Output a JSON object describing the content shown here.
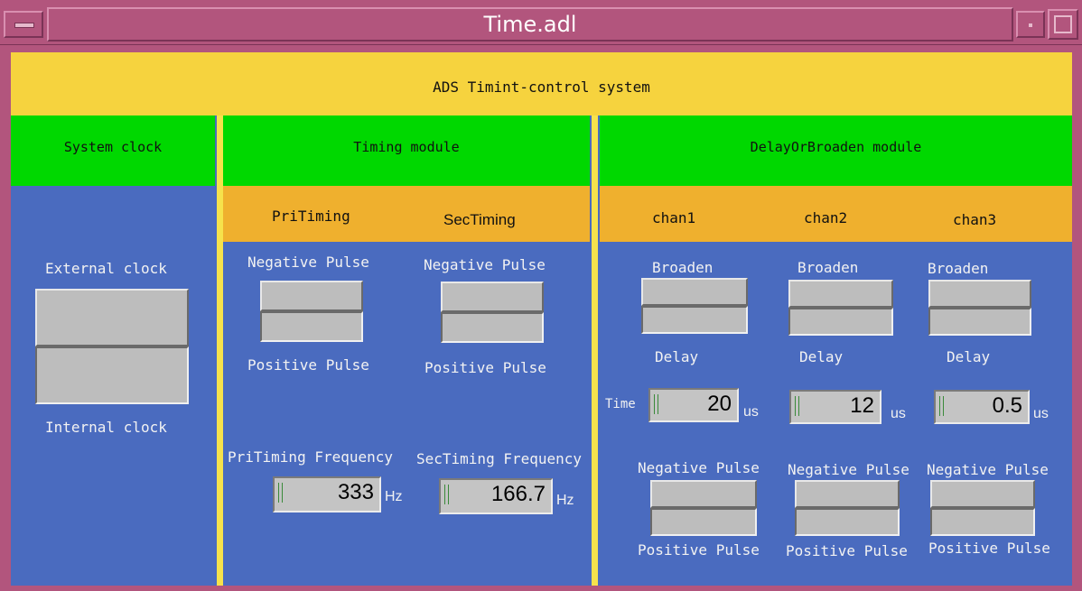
{
  "window": {
    "title": "Time.adl"
  },
  "header": {
    "title": "ADS Timint-control system"
  },
  "system_clock": {
    "heading": "System clock",
    "top_label": "External clock",
    "bottom_label": "Internal clock"
  },
  "timing_module": {
    "heading": "Timing module",
    "pri": {
      "tab": "PriTiming",
      "top_label": "Negative Pulse",
      "bottom_label": "Positive Pulse",
      "freq_label": "PriTiming Frequency",
      "freq_value": "333",
      "freq_unit": "Hz"
    },
    "sec": {
      "tab": "SecTiming",
      "top_label": "Negative Pulse",
      "bottom_label": "Positive Pulse",
      "freq_label": "SecTiming Frequency",
      "freq_value": "166.7",
      "freq_unit": "Hz"
    }
  },
  "delay_module": {
    "heading": "DelayOrBroaden module",
    "time_label": "Time",
    "channels": [
      {
        "name": "chan1",
        "broaden": "Broaden",
        "delay": "Delay",
        "value": "20",
        "unit": "us",
        "neg": "Negative Pulse",
        "pos": "Positive Pulse"
      },
      {
        "name": "chan2",
        "broaden": "Broaden",
        "delay": "Delay",
        "value": "12",
        "unit": "us",
        "neg": "Negative Pulse",
        "pos": "Positive Pulse"
      },
      {
        "name": "chan3",
        "broaden": "Broaden",
        "delay": "Delay",
        "value": "0.5",
        "unit": "us",
        "neg": "Negative Pulse",
        "pos": "Positive Pulse"
      }
    ]
  },
  "colors": {
    "frame": "#b2557d",
    "panel_bg": "#4a6bbf",
    "header_yellow": "#f6d33e",
    "module_green": "#00d800",
    "tab_orange": "#efb02e",
    "control_grey": "#bdbdbd"
  }
}
